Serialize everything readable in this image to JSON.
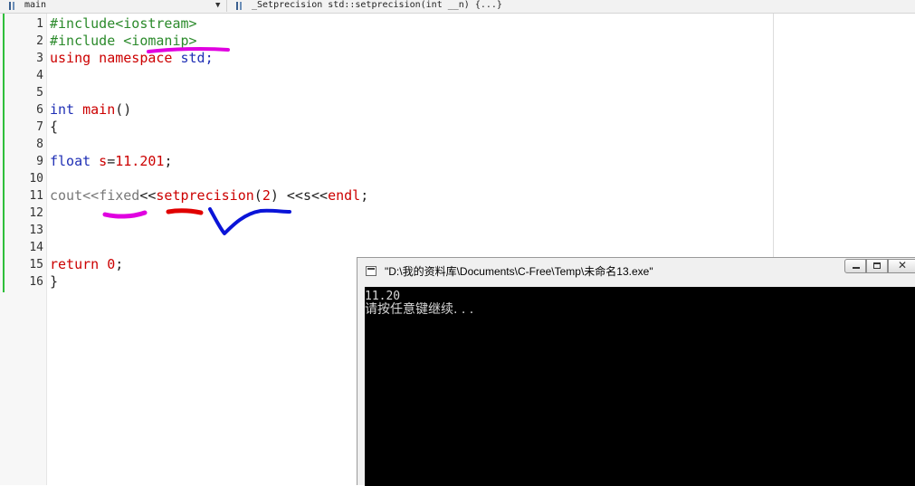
{
  "toolbar": {
    "function_combo": "main",
    "member_combo": "_Setprecision std::setprecision(int __n) {...}"
  },
  "editor": {
    "line_numbers": [
      "1",
      "2",
      "3",
      "4",
      "5",
      "6",
      "7",
      "8",
      "9",
      "10",
      "11",
      "12",
      "13",
      "14",
      "15",
      "16"
    ],
    "lines": {
      "l1": {
        "p1": "#include<iostream>"
      },
      "l2": {
        "p1": "#include <iomanip>"
      },
      "l3": {
        "p1": "using",
        "p2": " namespace ",
        "p3": "std;"
      },
      "l6": {
        "p1": "int",
        "p2": " main",
        "p3": "()"
      },
      "l7": {
        "p1": "{"
      },
      "l9": {
        "p1": "float",
        "p2": " s",
        "p3": "=",
        "p4": "11.201",
        "p5": ";"
      },
      "l11": {
        "p1": "cout<<",
        "p2": "fixed",
        "p3": "<<",
        "p4": "setprecision",
        "p5": "(",
        "p6": "2",
        "p7": ") <<s<<",
        "p8": "endl",
        "p9": ";"
      },
      "l15": {
        "p1": "return",
        "p2": " ",
        "p3": "0",
        "p4": ";"
      },
      "l16": {
        "p1": "}"
      }
    }
  },
  "console": {
    "title": "\"D:\\我的资料库\\Documents\\C-Free\\Temp\\未命名13.exe\"",
    "output": [
      "11.20",
      "请按任意键继续. . ."
    ]
  },
  "colors": {
    "gutter_bar": "#2fbf3a",
    "annotation_magenta": "#e000e0",
    "annotation_red": "#e00000",
    "annotation_blue": "#0a14d8"
  }
}
